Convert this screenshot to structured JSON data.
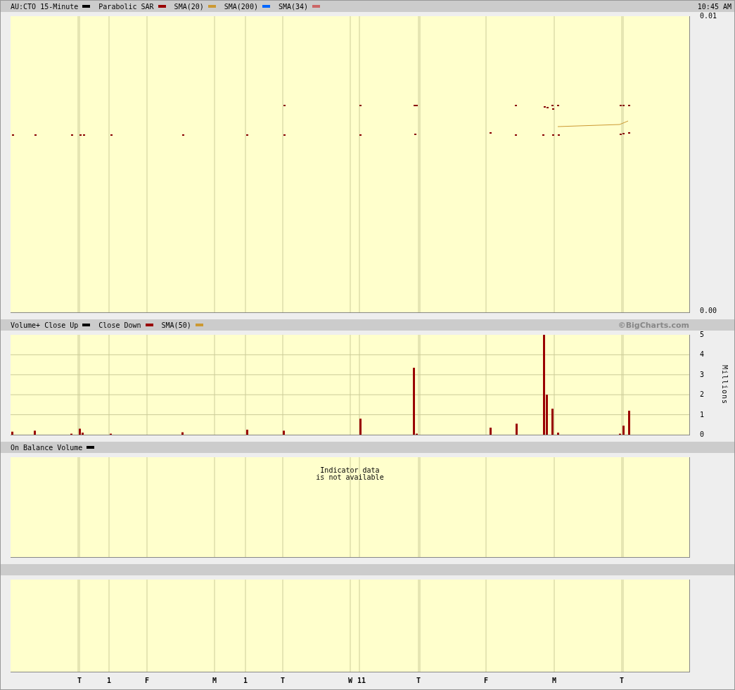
{
  "price_panel": {
    "legend": [
      {
        "label": "AU:CTO 15-Minute",
        "color": "#000000"
      },
      {
        "label": "Parabolic SAR",
        "color": "#990000"
      },
      {
        "label": "SMA(20)",
        "color": "#cc9933"
      },
      {
        "label": "SMA(200)",
        "color": "#0066ff"
      },
      {
        "label": "SMA(34)",
        "color": "#cc6666"
      }
    ],
    "time": "10:45 AM",
    "axis_labels": [
      "0.01",
      "0.00"
    ]
  },
  "volume_panel": {
    "legend": [
      {
        "label": "Volume+"
      },
      {
        "label": "Close Up",
        "color": "#000000"
      },
      {
        "label": "Close Down",
        "color": "#990000"
      },
      {
        "label": "SMA(50)",
        "color": "#cc9933"
      }
    ],
    "credit": "©BigCharts.com",
    "axis_labels": [
      "5",
      "4",
      "3",
      "2",
      "1",
      "0"
    ],
    "axis_title": "Millions"
  },
  "obv_panel": {
    "legend": [
      {
        "label": "On Balance Volume",
        "color": "#000000"
      }
    ],
    "message": "Indicator data\nis not available"
  },
  "x_axis": {
    "labels": [
      "T",
      "1",
      "F",
      "M",
      "1",
      "T",
      "W",
      "11",
      "T",
      "F",
      "M",
      "T"
    ]
  }
}
